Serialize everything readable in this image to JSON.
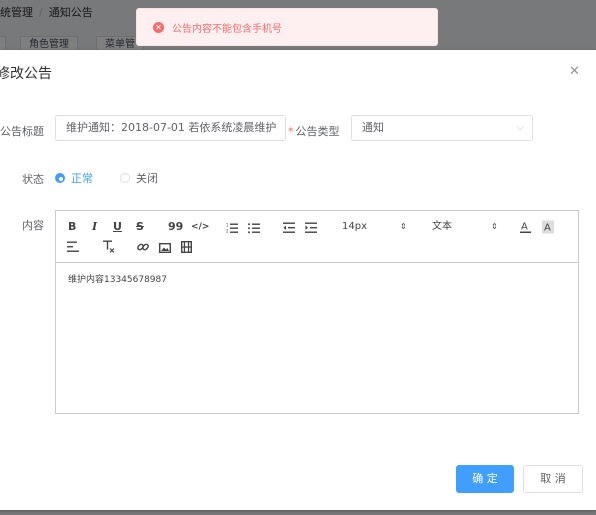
{
  "background": {
    "breadcrumb": [
      "统管理",
      "通知公告"
    ],
    "tags": [
      "",
      "角色管理",
      "菜单管"
    ]
  },
  "toast": {
    "message": "公告内容不能包含手机号",
    "icon": "error-circle-icon"
  },
  "dialog": {
    "title": "修改公告",
    "close_icon": "close-icon",
    "fields": {
      "title_label": "公告标题",
      "title_value": "维护通知：2018-07-01 若依系统凌晨维护",
      "type_label": "公告类型",
      "type_value": "通知",
      "status_label": "状态",
      "status_options": [
        "正常",
        "关闭"
      ],
      "status_selected": "正常",
      "content_label": "内容"
    },
    "editor": {
      "toolbar": {
        "bold": "B",
        "italic": "I",
        "underline": "U",
        "strike": "S",
        "blockquote": "99",
        "code": "</>",
        "size": "14px",
        "header": "文本",
        "size_arrow": "⇕",
        "header_arrow": "⇕"
      },
      "content": "维护内容13345678987"
    },
    "buttons": {
      "confirm": "确 定",
      "cancel": "取 消"
    }
  },
  "colors": {
    "primary": "#409eff",
    "error": "#f56c6c",
    "toast_bg": "#fef0f0"
  }
}
